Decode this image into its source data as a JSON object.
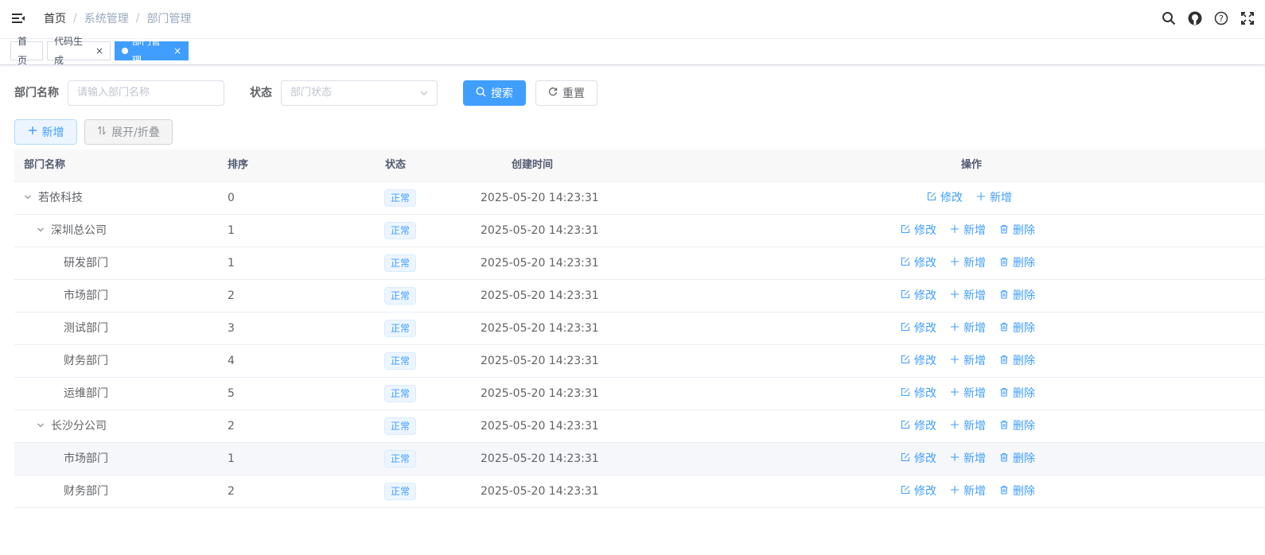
{
  "navbar": {
    "breadcrumb": [
      "首页",
      "系统管理",
      "部门管理"
    ],
    "breadcrumb_sep": "/",
    "icons": [
      "search-icon",
      "github-icon",
      "question-icon",
      "fullscreen-icon"
    ]
  },
  "tags": [
    {
      "label": "首页",
      "closable": false,
      "active": false
    },
    {
      "label": "代码生成",
      "closable": true,
      "active": false
    },
    {
      "label": "部门管理",
      "closable": true,
      "active": true
    }
  ],
  "search": {
    "dept_name_label": "部门名称",
    "dept_name_placeholder": "请输入部门名称",
    "status_label": "状态",
    "status_placeholder": "部门状态",
    "search_button": "搜索",
    "reset_button": "重置"
  },
  "toolbar": {
    "add_button": "新增",
    "expand_button": "展开/折叠"
  },
  "table": {
    "headers": {
      "name": "部门名称",
      "sort": "排序",
      "status": "状态",
      "created": "创建时间",
      "actions": "操作"
    },
    "action_labels": {
      "edit": "修改",
      "add": "新增",
      "delete": "删除"
    },
    "rows": [
      {
        "name": "若依科技",
        "sort": "0",
        "status": "正常",
        "created": "2025-05-20 14:23:31",
        "level": 0,
        "expandable": true,
        "deletable": false
      },
      {
        "name": "深圳总公司",
        "sort": "1",
        "status": "正常",
        "created": "2025-05-20 14:23:31",
        "level": 1,
        "expandable": true,
        "deletable": true
      },
      {
        "name": "研发部门",
        "sort": "1",
        "status": "正常",
        "created": "2025-05-20 14:23:31",
        "level": 2,
        "expandable": false,
        "deletable": true
      },
      {
        "name": "市场部门",
        "sort": "2",
        "status": "正常",
        "created": "2025-05-20 14:23:31",
        "level": 2,
        "expandable": false,
        "deletable": true
      },
      {
        "name": "测试部门",
        "sort": "3",
        "status": "正常",
        "created": "2025-05-20 14:23:31",
        "level": 2,
        "expandable": false,
        "deletable": true
      },
      {
        "name": "财务部门",
        "sort": "4",
        "status": "正常",
        "created": "2025-05-20 14:23:31",
        "level": 2,
        "expandable": false,
        "deletable": true
      },
      {
        "name": "运维部门",
        "sort": "5",
        "status": "正常",
        "created": "2025-05-20 14:23:31",
        "level": 2,
        "expandable": false,
        "deletable": true
      },
      {
        "name": "长沙分公司",
        "sort": "2",
        "status": "正常",
        "created": "2025-05-20 14:23:31",
        "level": 1,
        "expandable": true,
        "deletable": true
      },
      {
        "name": "市场部门",
        "sort": "1",
        "status": "正常",
        "created": "2025-05-20 14:23:31",
        "level": 2,
        "expandable": false,
        "deletable": true,
        "highlighted": true
      },
      {
        "name": "财务部门",
        "sort": "2",
        "status": "正常",
        "created": "2025-05-20 14:23:31",
        "level": 2,
        "expandable": false,
        "deletable": true
      }
    ]
  },
  "colors": {
    "primary": "#409eff",
    "tag_bg": "#ecf5ff",
    "header_bg": "#f8f8f9"
  }
}
